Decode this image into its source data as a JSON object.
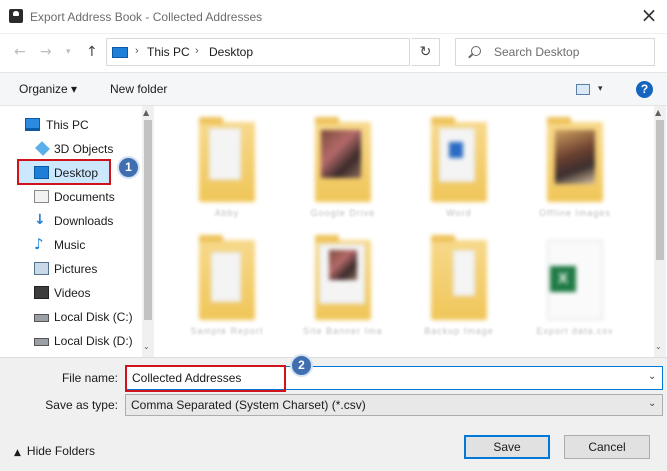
{
  "window": {
    "title": "Export Address Book - Collected Addresses",
    "close_glyph": "×"
  },
  "navigation": {
    "back_glyph": "←",
    "forward_glyph": "→",
    "recent_glyph": "▾",
    "up_glyph": "↑",
    "breadcrumb": [
      "This PC",
      "Desktop"
    ],
    "breadcrumb_separator": "›",
    "address_dropdown_glyph": "⌄",
    "refresh_glyph": "↻",
    "search_placeholder": "Search Desktop"
  },
  "toolbar": {
    "organize_label": "Organize ▾",
    "new_folder_label": "New folder",
    "view_dropdown_glyph": "▾",
    "help_label": "?"
  },
  "sidebar": {
    "items": [
      {
        "label": "This PC",
        "icon": "pc-icon"
      },
      {
        "label": "3D Objects",
        "icon": "3d-objects-icon"
      },
      {
        "label": "Desktop",
        "icon": "desktop-icon",
        "selected": true
      },
      {
        "label": "Documents",
        "icon": "documents-icon"
      },
      {
        "label": "Downloads",
        "icon": "downloads-icon",
        "glyph": "↓"
      },
      {
        "label": "Music",
        "icon": "music-icon",
        "glyph": "♪"
      },
      {
        "label": "Pictures",
        "icon": "pictures-icon"
      },
      {
        "label": "Videos",
        "icon": "videos-icon"
      },
      {
        "label": "Local Disk (C:)",
        "icon": "disk-icon"
      },
      {
        "label": "Local Disk (D:)",
        "icon": "disk-icon"
      }
    ],
    "scroll_up_glyph": "▲",
    "scroll_down_glyph": "⌄"
  },
  "callouts": {
    "step1": "1",
    "step2": "2"
  },
  "files": [
    {
      "kind": "folder",
      "caption": "Abby"
    },
    {
      "kind": "folder-photo",
      "caption": "Google Drive"
    },
    {
      "kind": "folder-word",
      "caption": "Word"
    },
    {
      "kind": "folder-photo2",
      "caption": "Offline Images"
    },
    {
      "kind": "folder",
      "caption": "Sample Report"
    },
    {
      "kind": "folder-photo3",
      "caption": "Site Banner Image"
    },
    {
      "kind": "folder",
      "caption": "Backup Image"
    },
    {
      "kind": "excel",
      "caption": "Export data.csv"
    }
  ],
  "form": {
    "file_name_label": "File name:",
    "file_name_value": "Collected Addresses",
    "save_as_type_label": "Save as type:",
    "save_as_type_value": "Comma Separated (System Charset) (*.csv)",
    "dropdown_glyph": "⌄"
  },
  "footer": {
    "hide_folders_glyph": "▲",
    "hide_folders_label": "Hide Folders",
    "save_label": "Save",
    "cancel_label": "Cancel"
  },
  "colors": {
    "callout_red": "#d0121c",
    "badge_blue": "#3f6fb1",
    "selection_blue": "#cce8ff",
    "accent": "#0078d7"
  }
}
